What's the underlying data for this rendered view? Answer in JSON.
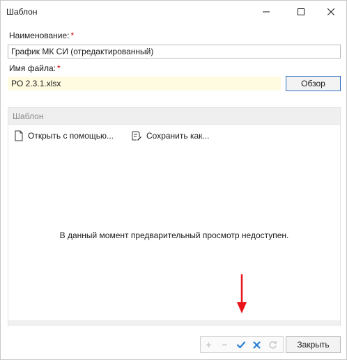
{
  "window": {
    "title": "Шаблон"
  },
  "form": {
    "name_label": "Наименование:",
    "name_required": "*",
    "name_value": "График МК СИ (отредактированный)",
    "file_label": "Имя файла:",
    "file_required": "*",
    "file_value": "PO 2.3.1.xlsx",
    "browse_label": "Обзор"
  },
  "template_panel": {
    "title": "Шаблон",
    "open_with_label": "Открыть с помощью...",
    "save_as_label": "Сохранить как...",
    "preview_message": "В данный момент предварительный просмотр недоступен."
  },
  "toolbar": {
    "add_glyph": "+",
    "remove_glyph": "−",
    "close_label": "Закрыть"
  },
  "colors": {
    "required": "#d40000",
    "file_field_bg": "#fffbe0",
    "accent_border": "#2f6fc6",
    "confirm": "#2a7fd4",
    "cancel": "#2a7fd4",
    "disabled": "#c8c8c8",
    "annotation_arrow": "#e8141a"
  }
}
